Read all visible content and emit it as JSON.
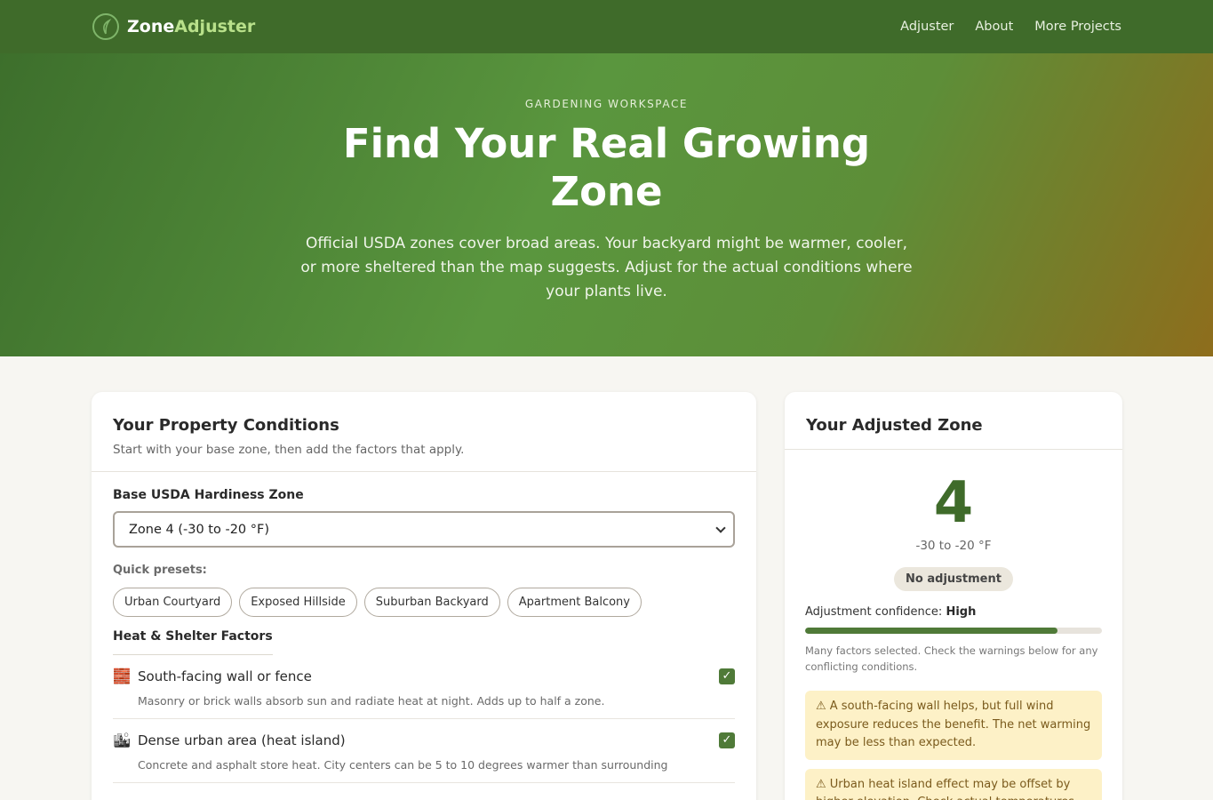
{
  "nav": {
    "brand_prefix": "Zone",
    "brand_suffix": "Adjuster",
    "links": [
      "Adjuster",
      "About",
      "More Projects"
    ]
  },
  "hero": {
    "eyebrow": "GARDENING WORKSPACE",
    "title": "Find Your Real Growing Zone",
    "subtitle": "Official USDA zones cover broad areas. Your backyard might be warmer, cooler, or more sheltered than the map suggests. Adjust for the actual conditions where your plants live."
  },
  "conditions": {
    "title": "Your Property Conditions",
    "description": "Start with your base zone, then add the factors that apply.",
    "base_zone_label": "Base USDA Hardiness Zone",
    "base_zone_value": "Zone 4 (-30 to -20 °F)",
    "presets_label": "Quick presets:",
    "presets": [
      "Urban Courtyard",
      "Exposed Hillside",
      "Suburban Backyard",
      "Apartment Balcony"
    ],
    "section_title": "Heat & Shelter Factors",
    "factors": [
      {
        "icon": "brick-icon",
        "name": "South-facing wall or fence",
        "description": "Masonry or brick walls absorb sun and radiate heat at night. Adds up to half a zone.",
        "checked": true
      },
      {
        "icon": "cityscape-icon",
        "name": "Dense urban area (heat island)",
        "description": "Concrete and asphalt store heat. City centers can be 5 to 10 degrees warmer than surrounding",
        "checked": true
      }
    ]
  },
  "result": {
    "title": "Your Adjusted Zone",
    "zone": "4",
    "range": "-30 to -20 °F",
    "badge": "No adjustment",
    "confidence_label": "Adjustment confidence:",
    "confidence_value": "High",
    "confidence_fraction": 0.85,
    "confidence_note": "Many factors selected. Check the warnings below for any conflicting conditions.",
    "warnings": [
      "⚠ A south-facing wall helps, but full wind exposure reduces the benefit. The net warming may be less than expected.",
      "⚠ Urban heat island effect may be offset by higher elevation. Check actual temperatures."
    ]
  },
  "colors": {
    "primary": "#3f6b2a",
    "accent": "#b8e08a",
    "warning_bg": "#fdf1c7"
  }
}
